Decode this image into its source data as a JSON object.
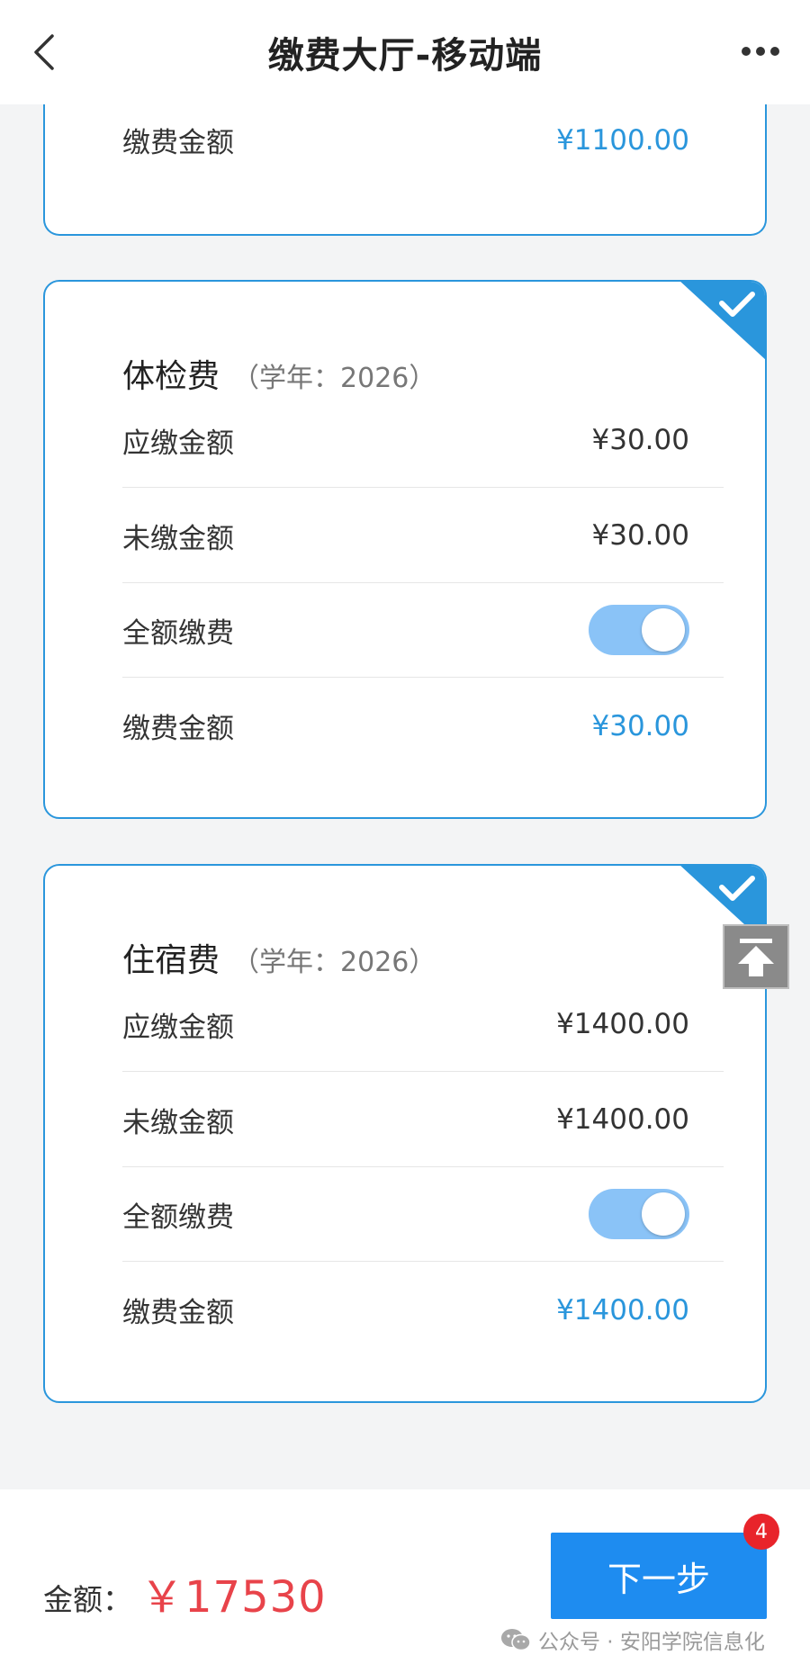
{
  "header": {
    "title": "缴费大厅-移动端"
  },
  "cards": [
    {
      "rows": [
        {
          "label": "缴费金额",
          "value": "¥1100.00"
        }
      ]
    },
    {
      "title": "体检费",
      "subtitle": "（学年：2026）",
      "selected": true,
      "rows": [
        {
          "label": "应缴金额",
          "value": "¥30.00"
        },
        {
          "label": "未缴金额",
          "value": "¥30.00"
        },
        {
          "label": "全额缴费",
          "toggle": true
        },
        {
          "label": "缴费金额",
          "value": "¥30.00"
        }
      ]
    },
    {
      "title": "住宿费",
      "subtitle": "（学年：2026）",
      "selected": true,
      "rows": [
        {
          "label": "应缴金额",
          "value": "¥1400.00"
        },
        {
          "label": "未缴金额",
          "value": "¥1400.00"
        },
        {
          "label": "全额缴费",
          "toggle": true
        },
        {
          "label": "缴费金额",
          "value": "¥1400.00"
        }
      ]
    }
  ],
  "footer": {
    "amount_label": "金额：",
    "amount_value": "￥17530",
    "next_label": "下一步",
    "badge_count": "4",
    "watermark": "公众号 · 安阳学院信息化"
  },
  "icons": {
    "back": "chevron-left-icon",
    "more": "more-dots-icon",
    "check": "check-icon",
    "to_top": "arrow-up-to-top-icon",
    "wechat": "wechat-icon"
  },
  "colors": {
    "accent": "#2a96dc",
    "button": "#1e8cf0",
    "amount": "#e8434a",
    "toggle": "#8ac3f7",
    "badge": "#e8242b"
  }
}
